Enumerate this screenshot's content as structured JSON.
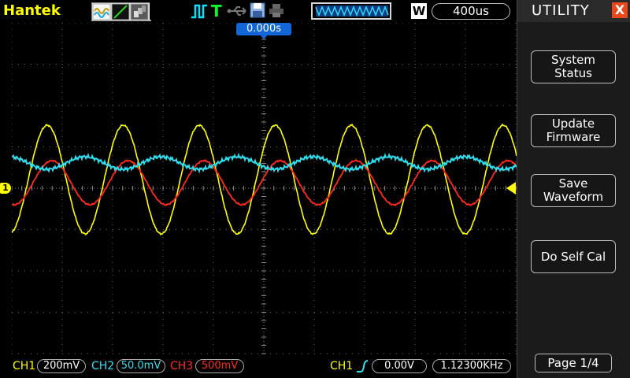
{
  "brand": "Hantek",
  "colors": {
    "ch1": "#ffff00",
    "ch2": "#2fe0f0",
    "ch3": "#ff2a1a",
    "trigger": "#ffff00",
    "menu_close": "#e8481c",
    "trig_pos": "#1266d8"
  },
  "toolbar": {
    "display_mode_icons": [
      "waveform-dots-icon",
      "vector-line-icon",
      "persist-icon"
    ],
    "trigger_mode_icon": "pulse-edge-icon",
    "trigger_type": "T",
    "usb_icon": "usb-icon",
    "save_icon": "floppy-save-icon",
    "print_icon": "printer-icon",
    "memory_icon": "memory-depth-icon",
    "acq_mode": "W",
    "timebase": "400us"
  },
  "trigger_position": "0.000s",
  "ch1_marker": "1",
  "bottom": {
    "ch1_label": "CH1",
    "ch1_scale": "200mV",
    "ch2_label": "CH2",
    "ch2_scale": "50.0mV",
    "ch3_label": "CH3",
    "ch3_scale": "500mV",
    "trig_source": "CH1",
    "trig_level": "0.00V",
    "frequency": "1.12300KHz"
  },
  "menu": {
    "title": "UTILITY",
    "close": "X",
    "buttons": [
      "System\nStatus",
      "Update\nFirmware",
      "Save\nWaveform",
      "Do Self Cal"
    ],
    "page": "Page 1/4"
  }
}
